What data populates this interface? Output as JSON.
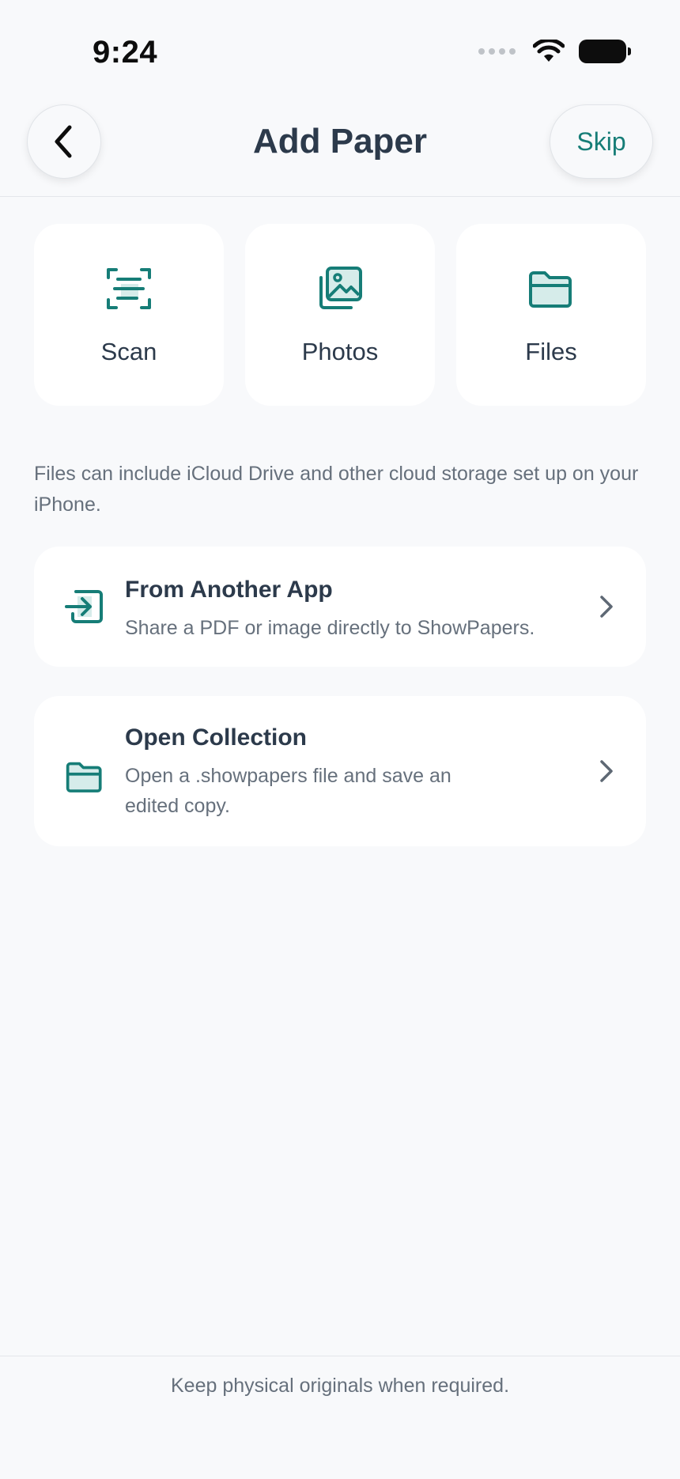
{
  "status_bar": {
    "time": "9:24"
  },
  "nav": {
    "title": "Add Paper",
    "skip_label": "Skip"
  },
  "tiles": [
    {
      "label": "Scan",
      "icon": "scan-icon"
    },
    {
      "label": "Photos",
      "icon": "photos-icon"
    },
    {
      "label": "Files",
      "icon": "folder-icon"
    }
  ],
  "note": "Files can include iCloud Drive and other cloud storage set up on your iPhone.",
  "options": [
    {
      "title": "From Another App",
      "subtitle": "Share a PDF or image directly to ShowPapers.",
      "icon": "import-icon"
    },
    {
      "title": "Open Collection",
      "subtitle": "Open a .showpapers file and save an edited copy.",
      "icon": "folder-icon"
    }
  ],
  "footer": "Keep physical originals when required.",
  "colors": {
    "accent": "#167d77",
    "background": "#f8f9fb",
    "card": "#ffffff",
    "text": "#2c3a4b",
    "muted": "#66707c"
  }
}
